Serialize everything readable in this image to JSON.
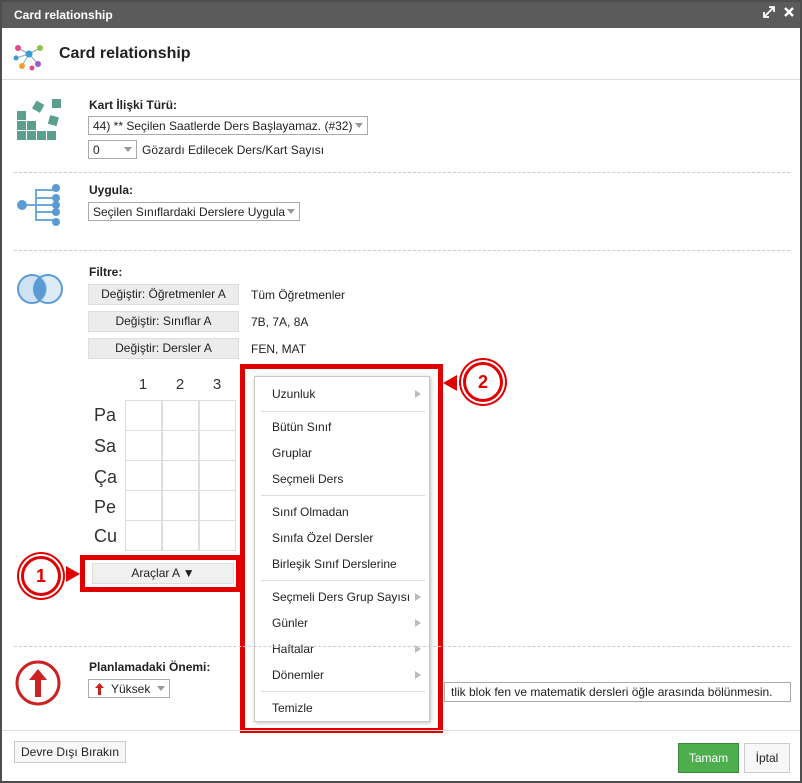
{
  "window": {
    "title": "Card relationship",
    "restore_icon": "resize-arrows-icon",
    "close_icon": "close-icon"
  },
  "header": {
    "title": "Card relationship"
  },
  "card_type": {
    "label": "Kart İlişki Türü:",
    "selected": "44) ** Seçilen Saatlerde Ders Başlayamaz. (#32)",
    "count_selected": "0",
    "count_label": "Gözardı Edilecek Ders/Kart Sayısı"
  },
  "apply": {
    "label": "Uygula:",
    "selected": "Seçilen Sınıflardaki Derslere Uygula"
  },
  "filter": {
    "label": "Filtre:",
    "rows": [
      {
        "button": "Değiştir: Öğretmenler A",
        "value": "Tüm Öğretmenler"
      },
      {
        "button": "Değiştir: Sınıflar A",
        "value": "7B, 7A, 8A"
      },
      {
        "button": "Değiştir: Dersler A",
        "value": "FEN, MAT"
      }
    ]
  },
  "grid": {
    "columns": [
      "1",
      "2",
      "3"
    ],
    "rows": [
      "Pa",
      "Sa",
      "Ça",
      "Pe",
      "Cu"
    ],
    "tools_button": "Araçlar A ▼"
  },
  "context_menu": {
    "items": [
      {
        "label": "Uzunluk",
        "submenu": true
      },
      {
        "label": "Bütün Sınıf",
        "submenu": false
      },
      {
        "label": "Gruplar",
        "submenu": false
      },
      {
        "label": "Seçmeli Ders",
        "submenu": false
      },
      {
        "label": "Sınıf Olmadan",
        "submenu": false
      },
      {
        "label": "Sınıfa Özel Dersler",
        "submenu": false
      },
      {
        "label": "Birleşik Sınıf Derslerine",
        "submenu": false
      },
      {
        "label": "Seçmeli Ders Grup Sayısı",
        "submenu": true
      },
      {
        "label": "Günler",
        "submenu": true
      },
      {
        "label": "Haftalar",
        "submenu": true
      },
      {
        "label": "Dönemler",
        "submenu": true
      },
      {
        "label": "Temizle",
        "submenu": false
      }
    ]
  },
  "callouts": {
    "one": "1",
    "two": "2",
    "color": "#e00000"
  },
  "importance": {
    "label": "Planlamadaki Önemi:",
    "selected": "Yüksek",
    "note": "tlik blok fen ve matematik dersleri öğle arasında bölünmesin."
  },
  "footer": {
    "disable": "Devre Dışı Bırakın",
    "ok": "Tamam",
    "cancel": "İptal"
  },
  "colors": {
    "titlebar": "#5b5b5b",
    "ok_button": "#4cae4c",
    "icon_green": "#5ba08f",
    "icon_blue": "#5b9bd5",
    "importance_red": "#cc2222"
  }
}
